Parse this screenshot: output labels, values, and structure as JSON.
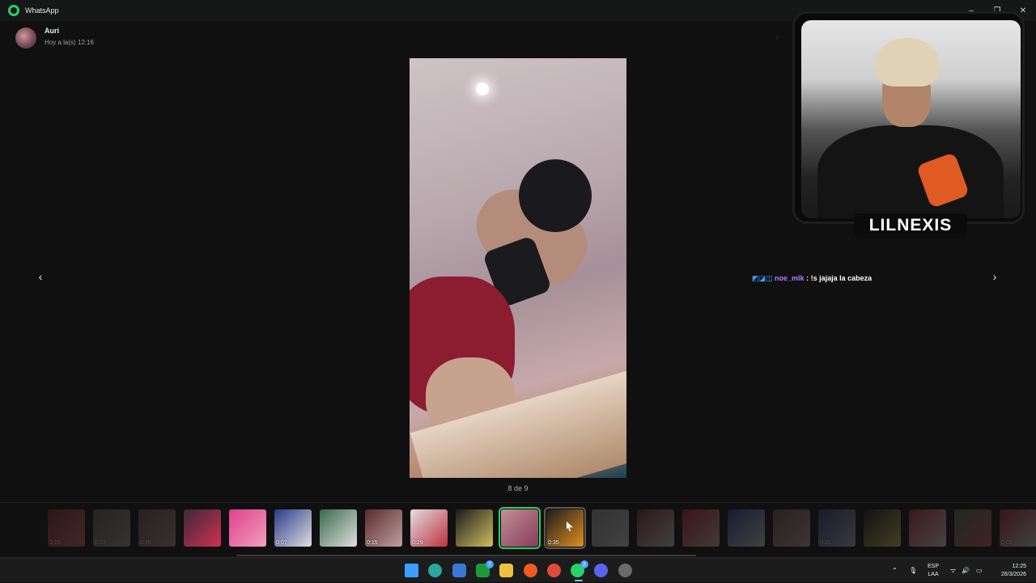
{
  "window": {
    "app_title": "WhatsApp",
    "controls": [
      "–",
      "❐",
      "✕"
    ]
  },
  "header": {
    "contact_name": "Auri",
    "last_seen": "Hoy a la(s) 12:16"
  },
  "viewer": {
    "counter": "8 de 9",
    "prev_icon": "‹",
    "next_icon": "›"
  },
  "stream": {
    "streamer_name": "LILNEXIS",
    "chat": {
      "badges": "◩◪◫",
      "user": "noe_mlk",
      "separator": ":",
      "message": "!s jajaja la cabeza"
    }
  },
  "thumbnails": [
    {
      "colors": [
        "#7a2a33",
        "#c06060"
      ],
      "duration": "0:15",
      "state": "dim"
    },
    {
      "colors": [
        "#5a5a5a",
        "#9a8a80"
      ],
      "duration": "0:13",
      "state": "dim"
    },
    {
      "colors": [
        "#6a4a4a",
        "#a08080"
      ],
      "duration": "0:16",
      "state": "dim"
    },
    {
      "colors": [
        "#3a2a3a",
        "#d03050"
      ],
      "duration": "",
      "state": "normal"
    },
    {
      "colors": [
        "#e0408a",
        "#f0a0c0"
      ],
      "duration": "",
      "state": "normal"
    },
    {
      "colors": [
        "#2a3a8a",
        "#e0e0e0"
      ],
      "duration": "0:07",
      "state": "normal"
    },
    {
      "colors": [
        "#3a6a4a",
        "#e0e0e0"
      ],
      "duration": "",
      "state": "normal"
    },
    {
      "colors": [
        "#5a2a2a",
        "#c0a0a0"
      ],
      "duration": "0:15",
      "state": "normal"
    },
    {
      "colors": [
        "#e0e0e0",
        "#c03040"
      ],
      "duration": "0:29",
      "state": "normal"
    },
    {
      "colors": [
        "#1a1a1a",
        "#d0c060"
      ],
      "duration": "",
      "state": "normal"
    },
    {
      "colors": [
        "#c09098",
        "#8a3a5a"
      ],
      "duration": "",
      "state": "active"
    },
    {
      "colors": [
        "#1a1a1a",
        "#e09020"
      ],
      "duration": "0:35",
      "state": "hover"
    },
    {
      "colors": [
        "#8a8a8a",
        "#c0c0c0"
      ],
      "duration": "",
      "state": "dim"
    },
    {
      "colors": [
        "#6a2a2a",
        "#c0c0c0"
      ],
      "duration": "",
      "state": "dim"
    },
    {
      "colors": [
        "#a02030",
        "#d0a0a0"
      ],
      "duration": "",
      "state": "dim"
    },
    {
      "colors": [
        "#2a3a8a",
        "#c0c0c0"
      ],
      "duration": "",
      "state": "dim"
    },
    {
      "colors": [
        "#6a4a4a",
        "#b09090"
      ],
      "duration": "",
      "state": "dim"
    },
    {
      "colors": [
        "#3a3a6a",
        "#a0a0c0"
      ],
      "duration": "0:21",
      "state": "dim"
    },
    {
      "colors": [
        "#1a1a1a",
        "#c0b060"
      ],
      "duration": "",
      "state": "dim"
    },
    {
      "colors": [
        "#a03040",
        "#e0c0c0"
      ],
      "duration": "",
      "state": "dim"
    },
    {
      "colors": [
        "#4a6a4a",
        "#c05060"
      ],
      "duration": "",
      "state": "dim"
    },
    {
      "colors": [
        "#a02030",
        "#c0c0c0"
      ],
      "duration": "0:02",
      "state": "dim"
    }
  ],
  "taskbar": {
    "icons": [
      {
        "name": "windows-start-icon",
        "color": "#3aa0ff",
        "badge": ""
      },
      {
        "name": "edge-icon",
        "color": "#2aa6a0",
        "badge": ""
      },
      {
        "name": "store-icon",
        "color": "#3a78d8",
        "badge": ""
      },
      {
        "name": "xbox-icon",
        "color": "#1c9a3a",
        "badge": "7"
      },
      {
        "name": "file-explorer-icon",
        "color": "#f0c040",
        "badge": ""
      },
      {
        "name": "brave-icon",
        "color": "#f05a24",
        "badge": ""
      },
      {
        "name": "chrome-icon",
        "color": "#e04a3a",
        "badge": ""
      },
      {
        "name": "whatsapp-icon",
        "color": "#25d366",
        "badge": "2"
      },
      {
        "name": "discord-icon",
        "color": "#5865f2",
        "badge": ""
      },
      {
        "name": "clock-app-icon",
        "color": "#6a6a6a",
        "badge": ""
      }
    ],
    "tray": {
      "chevron": "⌃",
      "mic": "🎙",
      "lang_top": "ESP",
      "lang_bottom": "LAA",
      "wifi": "ᯤ",
      "volume": "🔊",
      "battery": "▭",
      "time": "12:25",
      "date": "26/3/2026"
    }
  }
}
